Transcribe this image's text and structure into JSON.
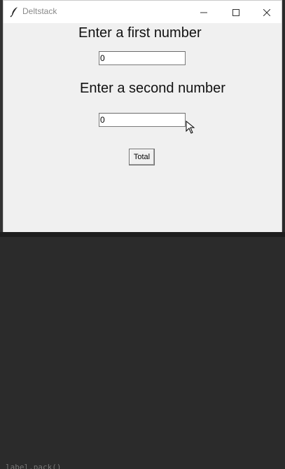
{
  "window": {
    "title": "Deltstack",
    "controls": {
      "minimize": "minimize-icon",
      "maximize": "maximize-icon",
      "close": "close-icon"
    }
  },
  "form": {
    "first_label": "Enter a first number",
    "first_value": "0",
    "second_label": "Enter a second number",
    "second_value": "0",
    "total_button": "Total"
  },
  "background": {
    "code_fragment": "label.pack()"
  },
  "colors": {
    "window_bg": "#f0f0f0",
    "titlebar_bg": "#ffffff",
    "title_text": "#8a8a8a"
  }
}
